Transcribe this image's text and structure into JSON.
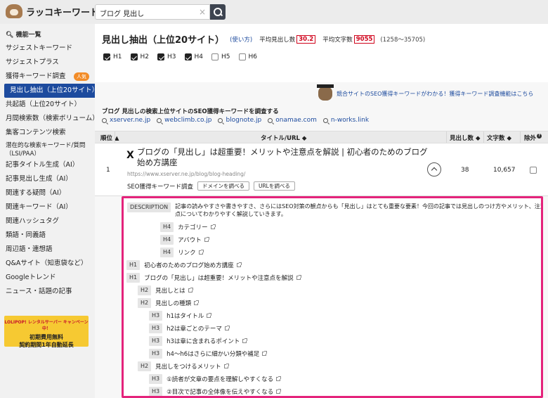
{
  "app": {
    "logo_text": "ラッコキーワード"
  },
  "search": {
    "value": "ブログ 見出し",
    "clear_glyph": "×"
  },
  "sidebar": {
    "header": "機能一覧",
    "items": [
      {
        "label": "サジェストキーワード"
      },
      {
        "label": "サジェストプラス"
      },
      {
        "label": "獲得キーワード調査",
        "badge": "人気"
      },
      {
        "label": "見出し抽出（上位20サイト）",
        "active": true
      },
      {
        "label": "共起語（上位20サイト）"
      },
      {
        "label": "月間検索数（検索ボリューム）"
      },
      {
        "label": "集客コンテンツ検索"
      },
      {
        "label": "潜在的な検索キーワード/質問（LSI/PAA）"
      },
      {
        "label": "記事タイトル生成（AI）"
      },
      {
        "label": "記事見出し生成（AI）"
      },
      {
        "label": "関連する疑問（AI）"
      },
      {
        "label": "関連キーワード（AI）"
      },
      {
        "label": "関連ハッシュタグ"
      },
      {
        "label": "類語・同義語"
      },
      {
        "label": "周辺語・連想語"
      },
      {
        "label": "Q&Aサイト（知恵袋など）"
      },
      {
        "label": "Googleトレンド"
      },
      {
        "label": "ニュース・話題の記事"
      }
    ],
    "promo": {
      "line1": "LOLIPOP! レンタルサーバー キャンペーン中！",
      "line2": "初期費用無料",
      "line3": "契約期間1年自動延長"
    }
  },
  "main": {
    "title": "見出し抽出（上位20サイト）",
    "usage_link": "(使い方)",
    "avg_heading_label": "平均見出し数",
    "avg_heading_value": "30.2",
    "avg_chars_label": "平均文字数",
    "avg_chars_value": "9055",
    "chars_range": "(1258〜35705)",
    "heading_filters": [
      {
        "label": "H1",
        "checked": true
      },
      {
        "label": "H2",
        "checked": true
      },
      {
        "label": "H3",
        "checked": true
      },
      {
        "label": "H4",
        "checked": true
      },
      {
        "label": "H5",
        "checked": false
      },
      {
        "label": "H6",
        "checked": false
      }
    ],
    "banner_text": "競合サイトのSEO獲得キーワードがわかる！獲得キーワード調査機能はこちら",
    "keyword_section_title": "ブログ 見出しの検索上位サイトのSEO獲得キーワードを調査する",
    "competitor_sites": [
      "xserver.ne.jp",
      "webclimb.co.jp",
      "blognote.jp",
      "onamae.com",
      "n-works.link"
    ],
    "table": {
      "headers": {
        "rank": "順位",
        "title_url": "タイトル/URL",
        "heading_count": "見出し数",
        "char_count": "文字数",
        "exclude": "除外",
        "help": "?"
      },
      "rows": [
        {
          "rank": "1",
          "site_icon": "X",
          "title": "ブログの「見出し」は超重要！メリットや注意点を解説 | 初心者のためのブログ始め方講座",
          "url": "https://www.xserver.ne.jp/blog/blog-heading/",
          "seo_label": "SEO獲得キーワード調査",
          "domain_button": "ドメインを調べる",
          "url_button": "URLを調べる",
          "heading_count": "38",
          "char_count": "10,657"
        }
      ]
    },
    "detail": {
      "description_tag": "DESCRIPTION",
      "description": "記事の読みやすさや書きやすさ、さらにはSEO対策の観点からも「見出し」はとても重要な要素！今回の記事では見出しのつけ方やメリット、注意点についてわかりやすく解説していきます。",
      "headings": [
        {
          "level": "H4",
          "text": "カテゴリー"
        },
        {
          "level": "H4",
          "text": "アバウト"
        },
        {
          "level": "H4",
          "text": "リンク"
        },
        {
          "level": "H1",
          "text": "初心者のためのブログ始め方講座"
        },
        {
          "level": "H1",
          "text": "ブログの「見出し」は超重要！メリットや注意点を解説"
        },
        {
          "level": "H2",
          "text": "見出しとは"
        },
        {
          "level": "H2",
          "text": "見出しの種類"
        },
        {
          "level": "H3",
          "text": "h1はタイトル"
        },
        {
          "level": "H3",
          "text": "h2は章ごとのテーマ"
        },
        {
          "level": "H3",
          "text": "h3は章に含まれるポイント"
        },
        {
          "level": "H3",
          "text": "h4〜h6はさらに細かい分類や補足"
        },
        {
          "level": "H2",
          "text": "見出しをつけるメリット"
        },
        {
          "level": "H3",
          "text": "①読者が文章の要点を理解しやすくなる"
        },
        {
          "level": "H3",
          "text": "②目次で記事の全体像を伝えやすくなる"
        }
      ]
    }
  }
}
